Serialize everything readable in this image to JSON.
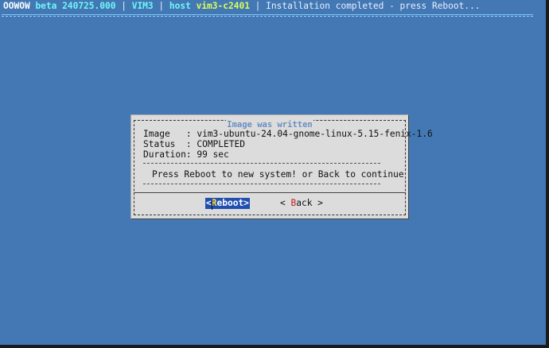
{
  "status_bar": {
    "brand": "OOWOW",
    "version": "beta 240725.000",
    "sep1": " | ",
    "device": "VIM3",
    "sep2": " | ",
    "host_label": "host",
    "host_name": "vim3-c2401",
    "sep3": " | ",
    "message": "Installation completed - press Reboot..."
  },
  "dialog": {
    "title": "Image was written",
    "image_line": "Image   : vim3-ubuntu-24.04-gnome-linux-5.15-fenix-1.6",
    "status_line": "Status  : COMPLETED",
    "duration_line": "Duration: 99 sec",
    "message": "Press Reboot to new system! or Back to continue"
  },
  "buttons": {
    "reboot_open": "<",
    "reboot_hot": "R",
    "reboot_rest": "eboot>",
    "back_open": "< ",
    "back_hot": "B",
    "back_rest": "ack >"
  },
  "colors": {
    "background": "#4378b4",
    "dialog": "#dcdcdc",
    "selected_button": "#1f4fb0",
    "title": "#6b8fc2"
  }
}
